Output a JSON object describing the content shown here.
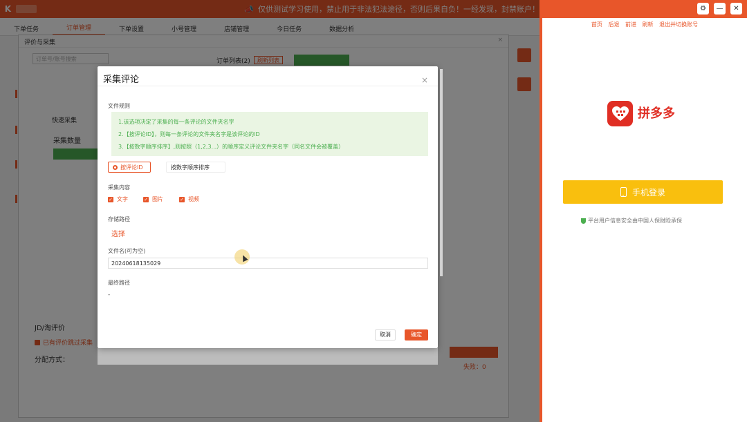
{
  "app": {
    "logo": "K",
    "notice": "仅供测试学习使用，禁止用于非法犯法途径，否则后果自负！一经发现，封禁账户！",
    "nav": [
      "下单任务",
      "订单管理",
      "下单设置",
      "小号管理",
      "店铺管理",
      "今日任务",
      "数据分析"
    ],
    "nav_active_index": 1,
    "panel_title": "评价与采集",
    "panel_search_placeholder": "订单号/账号搜索",
    "orders_label": "订单列表(2)",
    "orders_badge": "刷新列表",
    "side_tab": "快速采集",
    "side_title": "采集数量",
    "jd_label": "JD/淘评价",
    "jd_check": "已有评价跳过采集",
    "distribute": "分配方式：",
    "close_label": "关闭",
    "fail_label": "失败：0"
  },
  "modal": {
    "title": "采集评论",
    "file_rules_label": "文件规则",
    "rules": [
      "1.该选项决定了采集的每一条评论的文件夹名字",
      "2.【按评论ID】，则每一条评论的文件夹名字是该评论的ID",
      "3.【按数字顺序排序】,则按照（1,2,3...）的顺序定义评论文件夹名字（同名文件会被覆盖）"
    ],
    "sort_options": [
      {
        "label": "按评论ID",
        "selected": true
      },
      {
        "label": "按数字顺序排序",
        "selected": false
      }
    ],
    "content_label": "采集内容",
    "content_options": [
      {
        "label": "文字",
        "checked": true
      },
      {
        "label": "图片",
        "checked": true
      },
      {
        "label": "视频",
        "checked": true
      }
    ],
    "storage_label": "存储路径",
    "choose_label": "选择",
    "filename_label": "文件名(可为空)",
    "filename_value": "20240618135029",
    "final_path_label": "最终路径",
    "final_path_value": "-",
    "cancel_label": "取消",
    "ok_label": "确定"
  },
  "browser": {
    "nav": [
      "首页",
      "后退",
      "前进",
      "刷新",
      "退出并切换账号"
    ],
    "brand": "拼多多",
    "phone_login": "手机登录",
    "secure_text": "平台用户信息安全由中国人保财险承保"
  },
  "colors": {
    "accent": "#e8562a",
    "green": "#4caf50",
    "yellow": "#f9bf0e",
    "pdd_red": "#e02e24"
  }
}
